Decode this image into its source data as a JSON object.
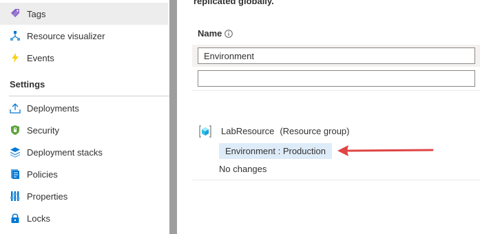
{
  "sidebar": {
    "items": [
      {
        "label": "Tags",
        "icon": "tag-icon",
        "active": true
      },
      {
        "label": "Resource visualizer",
        "icon": "resource-visualizer-icon"
      },
      {
        "label": "Events",
        "icon": "lightning-icon"
      }
    ],
    "settings_header": "Settings",
    "settings_items": [
      {
        "label": "Deployments",
        "icon": "upload-icon"
      },
      {
        "label": "Security",
        "icon": "shield-icon"
      },
      {
        "label": "Deployment stacks",
        "icon": "stack-icon"
      },
      {
        "label": "Policies",
        "icon": "policy-icon"
      },
      {
        "label": "Properties",
        "icon": "properties-icon"
      },
      {
        "label": "Locks",
        "icon": "lock-icon"
      }
    ]
  },
  "main": {
    "intro_text": "replicated globally.",
    "name_label": "Name",
    "tag_name_value": "Environment",
    "tag_name_new_value": "",
    "resource": {
      "name": "LabResource",
      "type": "(Resource group)",
      "tag_change": "Environment : Production",
      "status": "No changes"
    }
  },
  "colors": {
    "accent": "#0078d4",
    "chip_bg": "#deecf9",
    "annotation_arrow": "#e04444",
    "splitter": "#9e9e9e"
  }
}
